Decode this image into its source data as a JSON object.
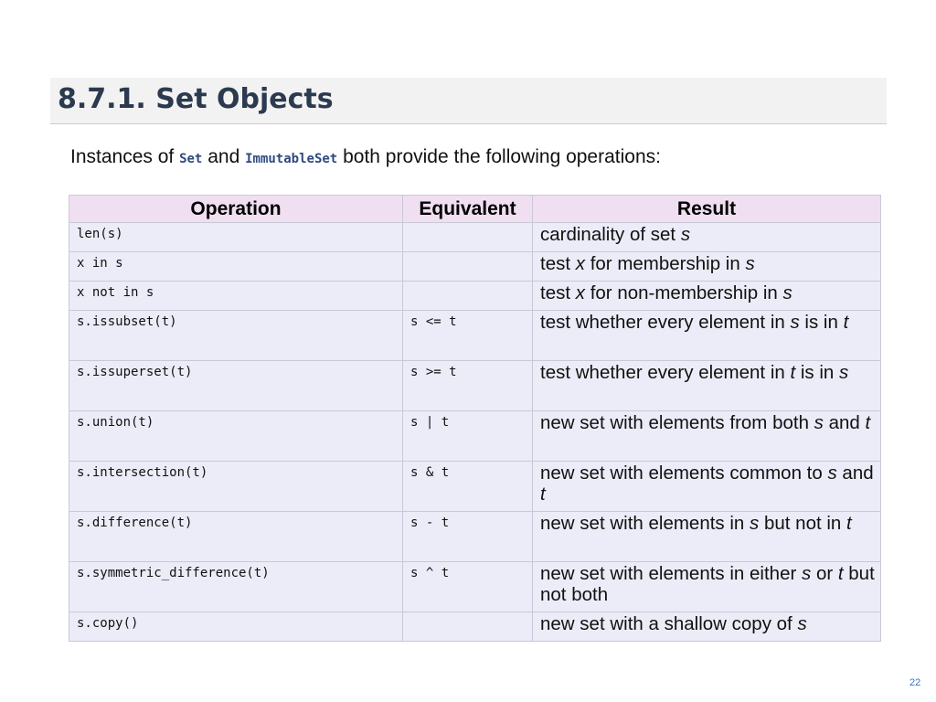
{
  "heading": {
    "title": "8.7.1. Set Objects"
  },
  "intro": {
    "prefix": "Instances of ",
    "class_a": "Set",
    "middle": " and ",
    "class_b": "ImmutableSet",
    "suffix": " both provide the following operations:"
  },
  "table": {
    "headers": [
      "Operation",
      "Equivalent",
      "Result"
    ],
    "rows": [
      {
        "operation": "len(s)",
        "equivalent": "",
        "result_html": "cardinality of set <i>s</i>"
      },
      {
        "operation": "x in s",
        "equivalent": "",
        "result_html": "test <i>x</i> for membership in <i>s</i>"
      },
      {
        "operation": "x not in s",
        "equivalent": "",
        "result_html": "test <i>x</i> for non-membership in <i>s</i>"
      },
      {
        "operation": "s.issubset(t)",
        "equivalent": "s <= t",
        "result_html": "test whether every element in <i>s</i> is in <i>t</i>"
      },
      {
        "operation": "s.issuperset(t)",
        "equivalent": "s >= t",
        "result_html": "test whether every element in <i>t</i> is in <i>s</i>"
      },
      {
        "operation": "s.union(t)",
        "equivalent": "s | t",
        "result_html": "new set with elements from both <i>s</i> and <i>t</i>"
      },
      {
        "operation": "s.intersection(t)",
        "equivalent": "s & t",
        "result_html": "new set with elements common to <i>s</i> and <i>t</i>"
      },
      {
        "operation": "s.difference(t)",
        "equivalent": "s - t",
        "result_html": "new set with elements in <i>s</i> but not in <i>t</i>"
      },
      {
        "operation": "s.symmetric_difference(t)",
        "equivalent": "s ^ t",
        "result_html": "new set with elements in either <i>s</i> or <i>t</i> but not both"
      },
      {
        "operation": "s.copy()",
        "equivalent": "",
        "result_html": "new set with a shallow copy of <i>s</i>"
      }
    ]
  },
  "footer": {
    "page_number": "22"
  }
}
